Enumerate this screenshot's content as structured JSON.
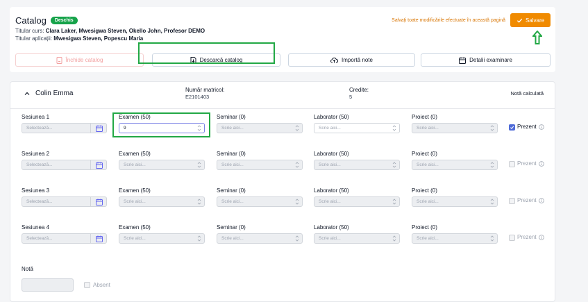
{
  "header": {
    "title": "Catalog",
    "status_badge": "Deschis",
    "titular_curs_label": "Titular curs:",
    "titular_curs_value": "Clara Laker, Mwesigwa Steven, Okello John, Profesor DEMO",
    "titular_aplicatii_label": "Titular aplicații:",
    "titular_aplicatii_value": "Mwesigwa Steven, Popescu Maria",
    "save_note": "Salvați toate modificările efectuate în această pagină",
    "save_label": "Salvare"
  },
  "actions": {
    "close_label": "Închide catalog",
    "download_label": "Descarcă catalog",
    "import_label": "Importă note",
    "details_label": "Detalii examinare"
  },
  "student": {
    "name": "Colin Emma",
    "matricol_label": "Număr matricol:",
    "matricol_value": "E2101403",
    "credits_label": "Credite:",
    "credits_value": "5",
    "computed_grade_label": "Notă calculată"
  },
  "labels": {
    "examen": "Examen (50)",
    "seminar": "Seminar (0)",
    "laborator": "Laborator (50)",
    "proiect": "Proiect (0)",
    "select_placeholder": "Selectează...",
    "write_placeholder": "Scrie aici...",
    "prezent": "Prezent",
    "nota": "Notă",
    "absent": "Absent"
  },
  "sessions": [
    {
      "name": "Sesiunea 1",
      "examen_value": "9",
      "prezent_checked": true
    },
    {
      "name": "Sesiunea 2",
      "examen_value": "",
      "prezent_checked": false
    },
    {
      "name": "Sesiunea 3",
      "examen_value": "",
      "prezent_checked": false
    },
    {
      "name": "Sesiunea 4",
      "examen_value": "",
      "prezent_checked": false
    }
  ],
  "colors": {
    "accent": "#f08a00",
    "badge": "#16a34a",
    "highlight": "#22a845",
    "checkbox": "#4f6bd8"
  }
}
